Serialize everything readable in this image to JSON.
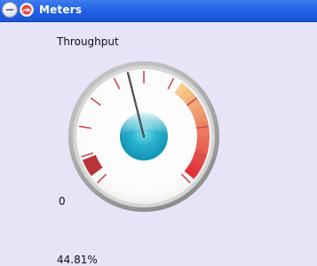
{
  "window": {
    "title": "Meters"
  },
  "gauge": {
    "title": "Throughput",
    "min_label": "0",
    "value_text": "44.81%",
    "value_percent": 44.81,
    "accent_colors": {
      "hub": "#1aa9c6",
      "low_zone": "#b8333a",
      "high_zone_start": "#f7c98a",
      "high_zone_end": "#e0343a",
      "ticks": "#c9484f",
      "needle": "#111111"
    }
  },
  "icons": {
    "collapse": "collapse-icon",
    "app": "meter-app-icon"
  }
}
